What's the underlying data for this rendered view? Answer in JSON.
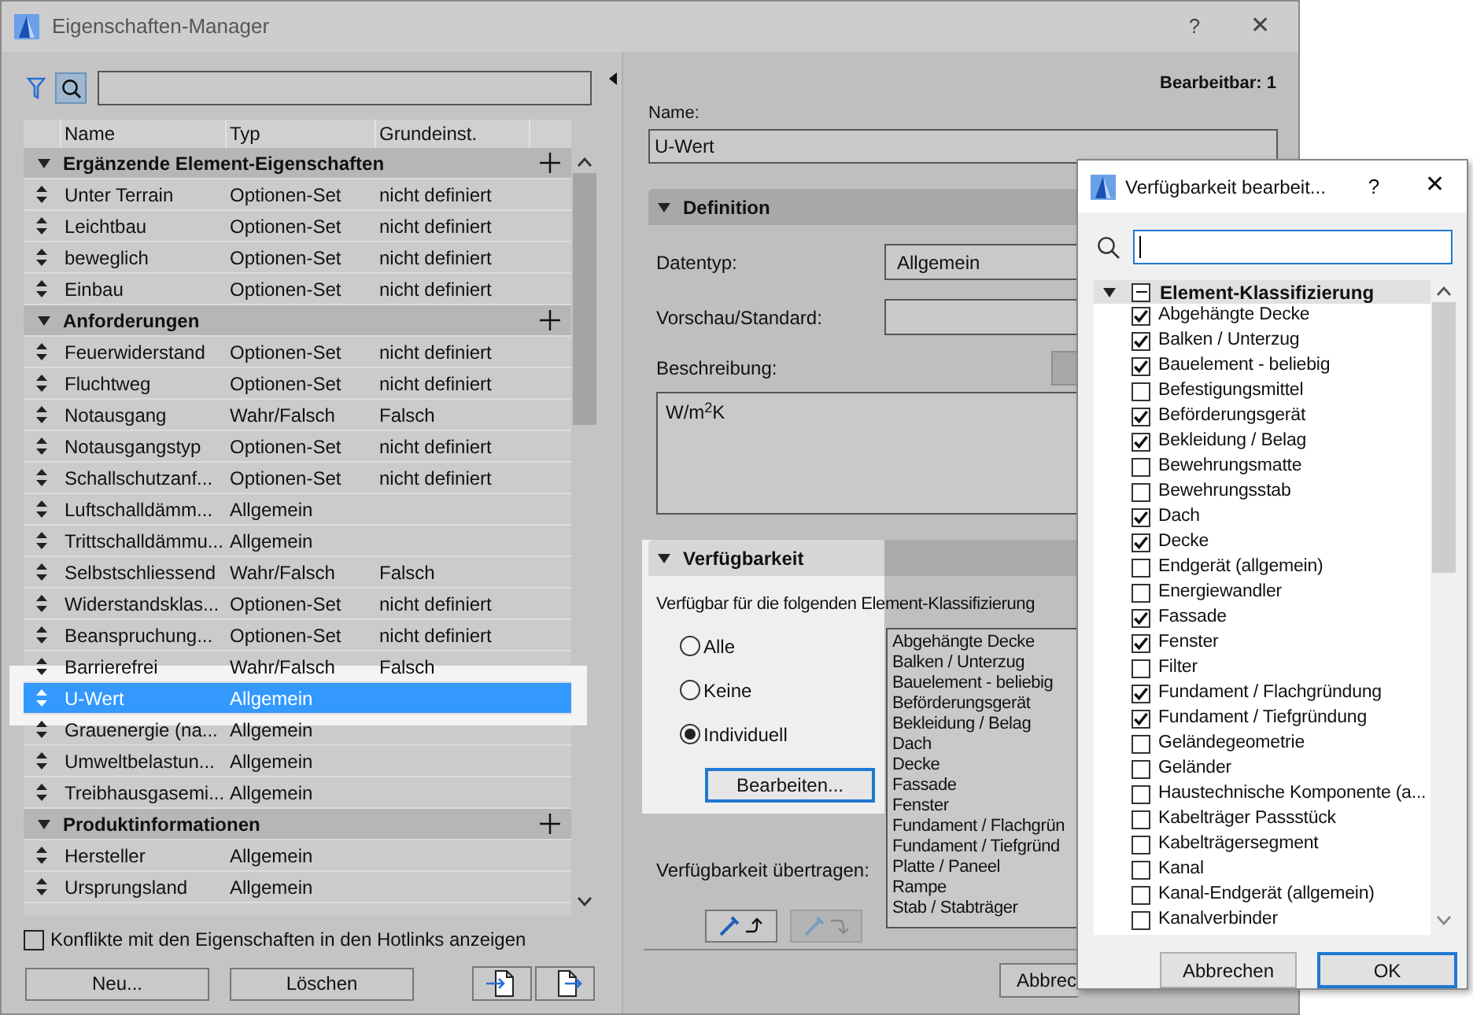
{
  "window": {
    "title": "Eigenschaften-Manager",
    "help": "?",
    "close": "✕"
  },
  "property_list": {
    "columns": [
      "Name",
      "Typ",
      "Grundeinst."
    ],
    "rows": [
      {
        "kind": "group",
        "label": "Ergänzende Element-Eigenschaften",
        "expanded": true
      },
      {
        "kind": "item",
        "name": "Unter Terrain",
        "type": "Optionen-Set",
        "default": "nicht definiert",
        "selected": false
      },
      {
        "kind": "item",
        "name": "Leichtbau",
        "type": "Optionen-Set",
        "default": "nicht definiert",
        "selected": false
      },
      {
        "kind": "item",
        "name": "beweglich",
        "type": "Optionen-Set",
        "default": "nicht definiert",
        "selected": false
      },
      {
        "kind": "item",
        "name": "Einbau",
        "type": "Optionen-Set",
        "default": "nicht definiert",
        "selected": false
      },
      {
        "kind": "group",
        "label": "Anforderungen",
        "expanded": true
      },
      {
        "kind": "item",
        "name": "Feuerwiderstand",
        "type": "Optionen-Set",
        "default": "nicht definiert",
        "selected": false
      },
      {
        "kind": "item",
        "name": "Fluchtweg",
        "type": "Optionen-Set",
        "default": "nicht definiert",
        "selected": false
      },
      {
        "kind": "item",
        "name": "Notausgang",
        "type": "Wahr/Falsch",
        "default": "Falsch",
        "selected": false
      },
      {
        "kind": "item",
        "name": "Notausgangstyp",
        "type": "Optionen-Set",
        "default": "nicht definiert",
        "selected": false
      },
      {
        "kind": "item",
        "name": "Schallschutzanf...",
        "type": "Optionen-Set",
        "default": "nicht definiert",
        "selected": false
      },
      {
        "kind": "item",
        "name": "Luftschalldämm...",
        "type": "Allgemein",
        "selected": false
      },
      {
        "kind": "item",
        "name": "Trittschalldämmu...",
        "type": "Allgemein",
        "selected": false
      },
      {
        "kind": "item",
        "name": "Selbstschliessend",
        "type": "Wahr/Falsch",
        "default": "Falsch",
        "selected": false
      },
      {
        "kind": "item",
        "name": "Widerstandsklas...",
        "type": "Optionen-Set",
        "default": "nicht definiert",
        "selected": false
      },
      {
        "kind": "item",
        "name": "Beanspruchung...",
        "type": "Optionen-Set",
        "default": "nicht definiert",
        "selected": false
      },
      {
        "kind": "item",
        "name": "Barrierefrei",
        "type": "Wahr/Falsch",
        "default": "Falsch",
        "selected": false
      },
      {
        "kind": "item",
        "name": "U-Wert",
        "type": "Allgemein",
        "selected": true
      },
      {
        "kind": "item",
        "name": "Grauenergie (na...",
        "type": "Allgemein",
        "selected": false
      },
      {
        "kind": "item",
        "name": "Umweltbelastun...",
        "type": "Allgemein",
        "selected": false
      },
      {
        "kind": "item",
        "name": "Treibhausgasemi...",
        "type": "Allgemein",
        "selected": false
      },
      {
        "kind": "group",
        "label": "Produktinformationen",
        "expanded": true
      },
      {
        "kind": "item",
        "name": "Hersteller",
        "type": "Allgemein",
        "selected": false
      },
      {
        "kind": "item",
        "name": "Ursprungsland",
        "type": "Allgemein",
        "selected": false
      }
    ]
  },
  "conflicts_checkbox": {
    "label": "Konflikte mit den Eigenschaften in den Hotlinks anzeigen",
    "checked": false
  },
  "buttons": [
    "Neu...",
    "Löschen"
  ],
  "details": {
    "editable": "Bearbeitbar: 1",
    "name_label": "Name:",
    "name_value": "U-Wert",
    "definition": {
      "title": "Definition",
      "expanded": true,
      "fields": [
        {
          "label": "Datentyp:",
          "value": "Allgemein"
        },
        {
          "label": "Vorschau/Standard:"
        }
      ],
      "description_label": "Beschreibung:",
      "description": "W/m$^{2}$K"
    },
    "availability": {
      "title": "Verfügbarkeit",
      "expanded": true,
      "intro": "Verfügbar für die folgenden Element-Klassifizierung",
      "options": [
        {
          "label": "Alle",
          "selected": false
        },
        {
          "label": "Keine",
          "selected": false
        },
        {
          "label": "Individuell",
          "selected": true
        }
      ],
      "edit_button": "Bearbeiten...",
      "classifications": [
        "Abgehängte Decke",
        "Balken / Unterzug",
        "Bauelement - beliebig",
        "Beförderungsgerät",
        "Bekleidung / Belag",
        "Dach",
        "Decke",
        "Fassade",
        "Fenster",
        "Fundament / Flachgrün",
        "Fundament / Tiefgründ",
        "Platte / Paneel",
        "Rampe",
        "Stab / Stabträger"
      ],
      "transfer_label": "Verfügbarkeit übertragen:"
    },
    "cancel_button": "Abbrec"
  },
  "dialog": {
    "title": "Verfügbarkeit bearbeit...",
    "help": "?",
    "close": "✕",
    "tree": {
      "label": "Element-Klassifizierung",
      "indeterminate": true,
      "expanded": true,
      "children": [
        {
          "label": "Abgehängte Decke",
          "checked": true
        },
        {
          "label": "Balken / Unterzug",
          "checked": true
        },
        {
          "label": "Bauelement - beliebig",
          "checked": true
        },
        {
          "label": "Befestigungsmittel",
          "checked": false
        },
        {
          "label": "Beförderungsgerät",
          "checked": true
        },
        {
          "label": "Bekleidung / Belag",
          "checked": true
        },
        {
          "label": "Bewehrungsmatte",
          "checked": false
        },
        {
          "label": "Bewehrungsstab",
          "checked": false
        },
        {
          "label": "Dach",
          "checked": true
        },
        {
          "label": "Decke",
          "checked": true
        },
        {
          "label": "Endgerät (allgemein)",
          "checked": false
        },
        {
          "label": "Energiewandler",
          "checked": false
        },
        {
          "label": "Fassade",
          "checked": true
        },
        {
          "label": "Fenster",
          "checked": true
        },
        {
          "label": "Filter",
          "checked": false
        },
        {
          "label": "Fundament / Flachgründung",
          "checked": true
        },
        {
          "label": "Fundament / Tiefgründung",
          "checked": true
        },
        {
          "label": "Geländegeometrie",
          "checked": false
        },
        {
          "label": "Geländer",
          "checked": false
        },
        {
          "label": "Haustechnische Komponente (a...",
          "checked": false
        },
        {
          "label": "Kabelträger Passstück",
          "checked": false
        },
        {
          "label": "Kabelträgersegment",
          "checked": false
        },
        {
          "label": "Kanal",
          "checked": false
        },
        {
          "label": "Kanal-Endgerät (allgemein)",
          "checked": false
        },
        {
          "label": "Kanalverbinder",
          "checked": false
        }
      ]
    },
    "buttons": [
      "Abbrechen",
      "OK"
    ]
  }
}
